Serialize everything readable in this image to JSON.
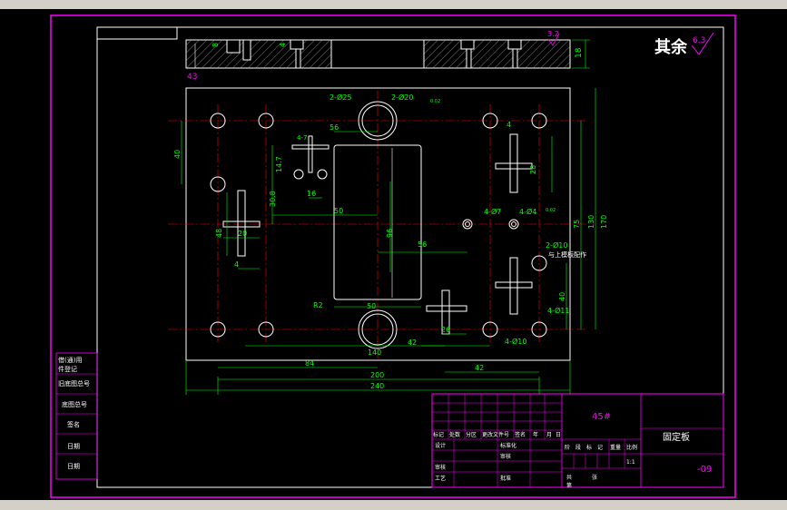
{
  "drawing": {
    "roughness_note": "其余",
    "roughness_value": "6.3",
    "roughness_value_top": "3.2",
    "material": "45#",
    "part_name": "固定板",
    "drawing_no": "-09"
  },
  "dims": {
    "top_h": "8",
    "top_h2": "4",
    "top_left": "43",
    "top_right_h": "18",
    "d1": "2-Ø25",
    "d2": "2-Ø20",
    "d2_tol": "0.02",
    "h56_top": "56",
    "h4_7": "4-7",
    "h16": "16",
    "h50": "50",
    "v40": "40",
    "v14_7": "14.7",
    "v30_8": "30.8",
    "v48": "48",
    "v96": "96",
    "h56_mid": "56",
    "h4_d7": "4-Ø7",
    "h4_d4": "4-Ø4",
    "h4_d4_tol": "0.02",
    "v28": "28",
    "v75": "75",
    "v130": "130",
    "v170": "170",
    "h2_d10": "2-Ø10",
    "h2_d10_note": "与上模板配作",
    "v40_r": "40",
    "h4_d11": "4-Ø11",
    "h26": "26",
    "h4_d10": "4-Ø10",
    "r2": "R2",
    "h50_bot": "50",
    "h140": "140",
    "h42a": "42",
    "h84": "84",
    "h42b": "42",
    "h200": "200",
    "h240": "240",
    "h20_l": "20",
    "h4_l": "4",
    "h4_tl": "4",
    "v28_r": "28"
  },
  "side_table": [
    "借(通)用",
    "件登记",
    "旧底图总号",
    "底图总号",
    "签名",
    "日期",
    "日期"
  ],
  "title_block": {
    "header_row": [
      "标记",
      "处数",
      "分区",
      "更改文件号",
      "签名",
      "年",
      "月",
      "日"
    ],
    "design": "设计",
    "standard": "标准化",
    "check_a": "审核",
    "process": "工艺",
    "review": "审核",
    "approve": "批准",
    "stage_cols": [
      "阶",
      "段",
      "标",
      "记",
      "重量",
      "比例"
    ],
    "scale": "1:1",
    "total": "共",
    "sheet": "张",
    "page": "第"
  }
}
